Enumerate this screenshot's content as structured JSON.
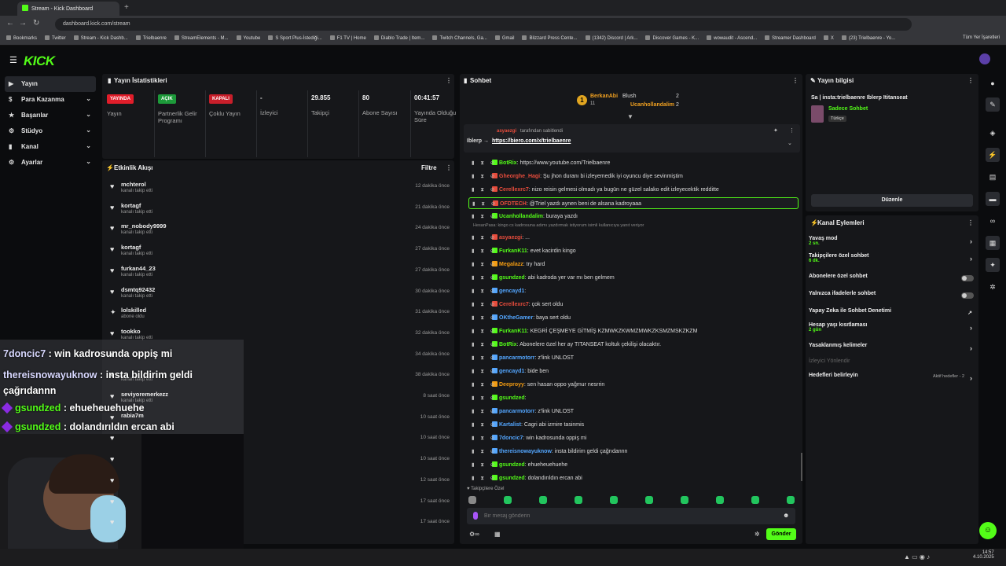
{
  "browser": {
    "tab_title": "Stream - Kick Dashboard",
    "url": "dashboard.kick.com/stream",
    "bookmarks": [
      "Bookmarks",
      "Twitter",
      "Stream - Kick Dashb...",
      "Trielbaenre",
      "StreamElements - M...",
      "Youtube",
      "S Sport Plus-İstediği...",
      "F1 TV | Home",
      "Diablo Trade | Item...",
      "Twitch Channels, Ga...",
      "Gmail",
      "Blizzard Press Cente...",
      "(1342) Discord | Ark...",
      "Discover Games - K...",
      "wowaudit - Ascend...",
      "Streamer Dashboard",
      "X",
      "(23) Trielbaenre - Yo..."
    ],
    "all_bookmarks": "Tüm Yer İşaretleri"
  },
  "logo": "KICK",
  "nav": [
    {
      "label": "Yayın",
      "active": true
    },
    {
      "label": "Para Kazanma"
    },
    {
      "label": "Başarılar"
    },
    {
      "label": "Stüdyo"
    },
    {
      "label": "Kanal"
    },
    {
      "label": "Ayarlar"
    }
  ],
  "stats_panel": {
    "title": "Yayın İstatistikleri",
    "items": [
      {
        "badge": "YAYINDA",
        "badge_color": "#e11d2a",
        "label": "Yayın"
      },
      {
        "badge": "AÇIK",
        "badge_color": "#1d9a3a",
        "label": "Partnerlik Gelir Programı"
      },
      {
        "badge": "KAPALI",
        "badge_color": "#c81e2a",
        "label": "Çoklu Yayın"
      },
      {
        "value": "-",
        "label": "İzleyici"
      },
      {
        "value": "29.855",
        "label": "Takipçi"
      },
      {
        "value": "80",
        "label": "Abone Sayısı"
      },
      {
        "value": "00:41:57",
        "label": "Yayında Olduğu Süre"
      }
    ]
  },
  "activity": {
    "title": "Etkinlik Akışı",
    "filter": "Filtre",
    "events": [
      {
        "name": "mchterol",
        "sub": "kanalı takip etti",
        "time": "12 dakika önce"
      },
      {
        "name": "kortagf",
        "sub": "kanalı takip etti",
        "time": "21 dakika önce"
      },
      {
        "name": "mr_nobody9999",
        "sub": "kanalı takip etti",
        "time": "24 dakika önce"
      },
      {
        "name": "kortagf",
        "sub": "kanalı takip etti",
        "time": "27 dakika önce"
      },
      {
        "name": "furkan44_23",
        "sub": "kanalı takip etti",
        "time": "27 dakika önce"
      },
      {
        "name": "dsmtq92432",
        "sub": "kanalı takip etti",
        "time": "30 dakika önce"
      },
      {
        "name": "lolskilled",
        "sub": "abone oldu",
        "time": "31 dakika önce"
      },
      {
        "name": "tookko",
        "sub": "kanalı takip etti",
        "time": "32 dakika önce"
      },
      {
        "name": "",
        "sub": "",
        "time": "34 dakika önce"
      },
      {
        "name": "",
        "sub": "kanalı takip etti",
        "time": "38 dakika önce"
      },
      {
        "name": "seviyoremerkezz",
        "sub": "kanalı takip etti",
        "time": "8 saat önce"
      },
      {
        "name": "rabia7m",
        "sub": "",
        "time": "10 saat önce"
      },
      {
        "name": "",
        "sub": "",
        "time": "10 saat önce"
      },
      {
        "name": "",
        "sub": "",
        "time": "10 saat önce"
      },
      {
        "name": "",
        "sub": "",
        "time": "12 saat önce"
      },
      {
        "name": "",
        "sub": "",
        "time": "17 saat önce"
      },
      {
        "name": "",
        "sub": "",
        "time": "17 saat önce"
      }
    ]
  },
  "chat": {
    "title": "Sohbet",
    "leaderboard": [
      {
        "name": "BerkanAbi",
        "count": "11"
      },
      {
        "name": "Blush",
        "count": "2"
      },
      {
        "name": "Ucanhollandalim",
        "count": "2"
      }
    ],
    "pinned_by": "asyaezgi",
    "pinned_suffix": "tarafından sabitlendi",
    "pinned_text": "Iblerp →",
    "pinned_link": "https://biero.com/x/trielbaenre",
    "messages": [
      {
        "user": "BotRix",
        "color": "#53fc18",
        "text": "https://www.youtube.com/Trielbaenre"
      },
      {
        "user": "Gheorghe_Hagi",
        "color": "#e74c3c",
        "text": "Şu jhon duranı bi izleyemedik iyi oyuncu diye sevinmiştim"
      },
      {
        "user": "Cerellexrc7",
        "color": "#e74c3c",
        "text": "nizo reisin gelmesi olmadı ya bugün ne güzel salako edit izleyecektik redditte"
      },
      {
        "user": "OFDTECH",
        "color": "#e74c3c",
        "text": "@Triel yazdı aynen beni de alsana kadroyaaa",
        "highlight": true
      },
      {
        "user": "Ucanhollandalim",
        "color": "#53fc18",
        "text": "buraya yazdı"
      },
      {
        "system": "HesanPasa: kingo cs kadrosuna adımı yazdırmak istiyorum isimli kullanıcıya yanıt veriyor"
      },
      {
        "user": "asyaezgi",
        "color": "#e74c3c",
        "text": "..."
      },
      {
        "user": "FurkanK11",
        "color": "#53fc18",
        "text": "evet kacirdin kingo"
      },
      {
        "user": "Megalazz",
        "color": "#f39c12",
        "text": "try hard"
      },
      {
        "user": "gsundzed",
        "color": "#53fc18",
        "text": "abi kadroda yer var mı ben gelmem"
      },
      {
        "user": "gencayd1",
        "color": "#53a6ff",
        "text": ""
      },
      {
        "user": "Cerellexrc7",
        "color": "#e74c3c",
        "text": "çok sert oldu"
      },
      {
        "user": "OKtheGamer",
        "color": "#53a6ff",
        "text": "baya sert oldu"
      },
      {
        "user": "FurkanK11",
        "color": "#53fc18",
        "text": "KEGRİ ÇEŞMEYE GİTMİŞ KZMWKZKWMZMWKZKSMZMSKZKZM"
      },
      {
        "user": "BotRix",
        "color": "#53fc18",
        "text": "Abonelere özel her ay TITANSEAT koltuk çekilişi olacaktır."
      },
      {
        "user": "pancarmotorr",
        "color": "#53a6ff",
        "text": "z'link UNLOST"
      },
      {
        "user": "gencayd1",
        "color": "#53a6ff",
        "text": "bide ben"
      },
      {
        "user": "Deeproyy",
        "color": "#f39c12",
        "text": "sen hasan oppo yağmur nesrrin"
      },
      {
        "user": "gsundzed",
        "color": "#53fc18",
        "text": ""
      },
      {
        "user": "pancarmotorr",
        "color": "#53a6ff",
        "text": "z'link UNLOST"
      },
      {
        "user": "Kartalist",
        "color": "#53a6ff",
        "text": "Cagri abi izmire tasinmis"
      },
      {
        "user": "7doncic7",
        "color": "#53a6ff",
        "text": "win kadrosunda oppiş mi"
      },
      {
        "user": "thereisnowayuknow",
        "color": "#53a6ff",
        "text": "insta bildirim geldi çağrıdannn"
      },
      {
        "user": "gsundzed",
        "color": "#53fc18",
        "text": "ehueheuehuehe"
      },
      {
        "user": "gsundzed",
        "color": "#53fc18",
        "text": "dolandırıldın ercan abi"
      }
    ],
    "follower_only": "Takipçilere Özel",
    "input_placeholder": "Bir mesaj gönderin",
    "send": "Gönder"
  },
  "stream_info": {
    "title": "Yayın bilgisi",
    "stream_title": "Sa | insta:trielbaenre Iblerp Ititanseat",
    "category": "Sadece Sohbet",
    "language": "Türkçe",
    "edit": "Düzenle"
  },
  "channel_actions": {
    "title": "Kanal Eylemleri",
    "items": [
      {
        "label": "Yavaş mod",
        "sub": "2 sn.",
        "type": "arrow"
      },
      {
        "label": "Takipçilere özel sohbet",
        "sub": "6 dk.",
        "type": "arrow"
      },
      {
        "label": "Abonelere özel sohbet",
        "type": "toggle"
      },
      {
        "label": "Yalnızca ifadelerle sohbet",
        "type": "toggle"
      },
      {
        "label": "Yapay Zeka ile Sohbet Denetimi",
        "type": "ext"
      },
      {
        "label": "Hesap yaşı kısıtlaması",
        "sub": "2 gün",
        "type": "arrow"
      },
      {
        "label": "Yasaklanmış kelimeler",
        "type": "arrow"
      },
      {
        "label": "İzleyici Yönlendir",
        "type": "disabled"
      },
      {
        "label": "Hedefleri belirleyin",
        "right": "Aktif hedefler - 2",
        "type": "arrow"
      }
    ]
  },
  "overlay": [
    {
      "user": "7doncic7",
      "text": " : win kadrosunda oppiş mi"
    },
    {
      "user": "thereisnowayuknow",
      "text": " : insta bildirim geldi çağrıdannn"
    },
    {
      "user": "gsundzed",
      "text": " : ehueheuehuehe"
    },
    {
      "user": "gsundzed",
      "text": " : dolandırıldın ercan abi"
    }
  ],
  "taskbar": {
    "time": "14:57",
    "date": "4.10.2025"
  }
}
